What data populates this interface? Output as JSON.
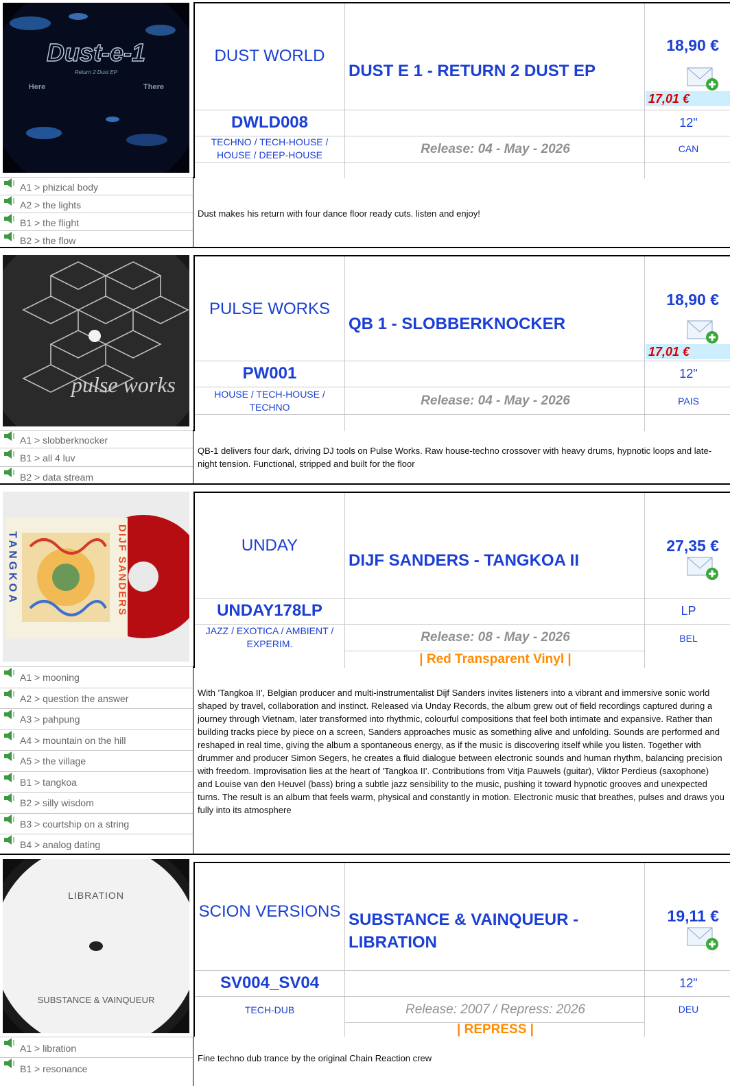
{
  "releases": [
    {
      "label": "DUST WORLD",
      "title": "DUST E 1 - RETURN 2 DUST EP",
      "price": "18,90 €",
      "promo_price": "17,01 €",
      "catalog": "DWLD008",
      "format": "12\"",
      "genres": "TECHNO / TECH-HOUSE / HOUSE / DEEP-HOUSE",
      "release_date": "Release: 04 - May - 2026",
      "country": "CAN",
      "note": "",
      "cover_text": {
        "logo": "Dust-e-1",
        "subtitle": "Return 2 Dust EP",
        "left_side": "Here",
        "right_side": "There"
      },
      "tracks": [
        "A1 > phizical body",
        "A2 > the lights",
        "B1 > the flight",
        "B2 > the flow"
      ],
      "description": "Dust makes his return with four dance floor ready cuts. listen and enjoy!"
    },
    {
      "label": "PULSE WORKS",
      "title": "QB 1 - SLOBBERKNOCKER",
      "price": "18,90 €",
      "promo_price": "17,01 €",
      "catalog": "PW001",
      "format": "12\"",
      "genres": "HOUSE / TECH-HOUSE / TECHNO",
      "release_date": "Release: 04 - May - 2026",
      "country": "PAIS",
      "note": "",
      "cover_text": {
        "logo": "pulse works"
      },
      "tracks": [
        "A1 > slobberknocker",
        "B1 > all 4 luv",
        "B2 > data stream"
      ],
      "description": "QB-1 delivers four dark, driving DJ tools on Pulse Works. Raw house-techno crossover with heavy drums, hypnotic loops and late-night tension. Functional, stripped and built for the floor"
    },
    {
      "label": "UNDAY",
      "title": "DIJF SANDERS - TANGKOA II",
      "price": "27,35 €",
      "promo_price": "",
      "catalog": "UNDAY178LP",
      "format": "LP",
      "genres": "JAZZ / EXOTICA / AMBIENT / EXPERIM.",
      "release_date": "Release: 08 - May - 2026",
      "country": "BEL",
      "note": "| Red Transparent Vinyl |",
      "cover_text": {
        "left": "TANGKOA",
        "right": "DIJF SANDERS"
      },
      "tracks": [
        "A1 > mooning",
        "A2 > question the answer",
        "A3 > pahpung",
        "A4 > mountain on the hill",
        "A5 > the village",
        "B1 > tangkoa",
        "B2 > silly wisdom",
        "B3 > courtship on a string",
        "B4 > analog dating"
      ],
      "description": "With 'Tangkoa II', Belgian producer and multi-instrumentalist Dijf Sanders invites listeners into a vibrant and immersive sonic world shaped by travel, collaboration and instinct. Released via Unday Records, the album grew out of field recordings captured during a journey through Vietnam, later transformed into rhythmic, colourful compositions that feel both intimate and expansive. Rather than building tracks piece by piece on a screen, Sanders approaches music as something alive and unfolding. Sounds are performed and reshaped in real time, giving the album a spontaneous energy, as if the music is discovering itself while you listen. Together with drummer and producer Simon Segers, he creates a fluid dialogue between electronic sounds and human rhythm, balancing precision with freedom. Improvisation lies at the heart of 'Tangkoa II'. Contributions from Vitja Pauwels (guitar), Viktor Perdieus (saxophone) and Louise van den Heuvel (bass) bring a subtle jazz sensibility to the music, pushing it toward hypnotic grooves and unexpected turns. The result is an album that feels warm, physical and constantly in motion. Electronic music that breathes, pulses and draws you fully into its atmosphere"
    },
    {
      "label": "SCION VERSIONS",
      "title": "SUBSTANCE & VAINQUEUR - LIBRATION",
      "price": "19,11 €",
      "promo_price": "",
      "catalog": "SV004_SV04",
      "format": "12\"",
      "genres": "TECH-DUB",
      "release_date": "Release: 2007 / Repress: 2026",
      "country": "DEU",
      "note": "| REPRESS |",
      "cover_text": {
        "title": "LIBRATION",
        "artist": "SUBSTANCE & VAINQUEUR"
      },
      "tracks": [
        "A1 > libration",
        "B1 > resonance"
      ],
      "description": "Fine techno dub trance by the original Chain Reaction crew"
    }
  ],
  "colors": {
    "link": "#1b3fd4",
    "promo_bg": "#cdeefc",
    "promo_text": "#d40000",
    "note": "#ff8c00",
    "muted": "#909090"
  },
  "icons": {
    "mail": "mail-add-icon",
    "speaker": "speaker-icon"
  }
}
